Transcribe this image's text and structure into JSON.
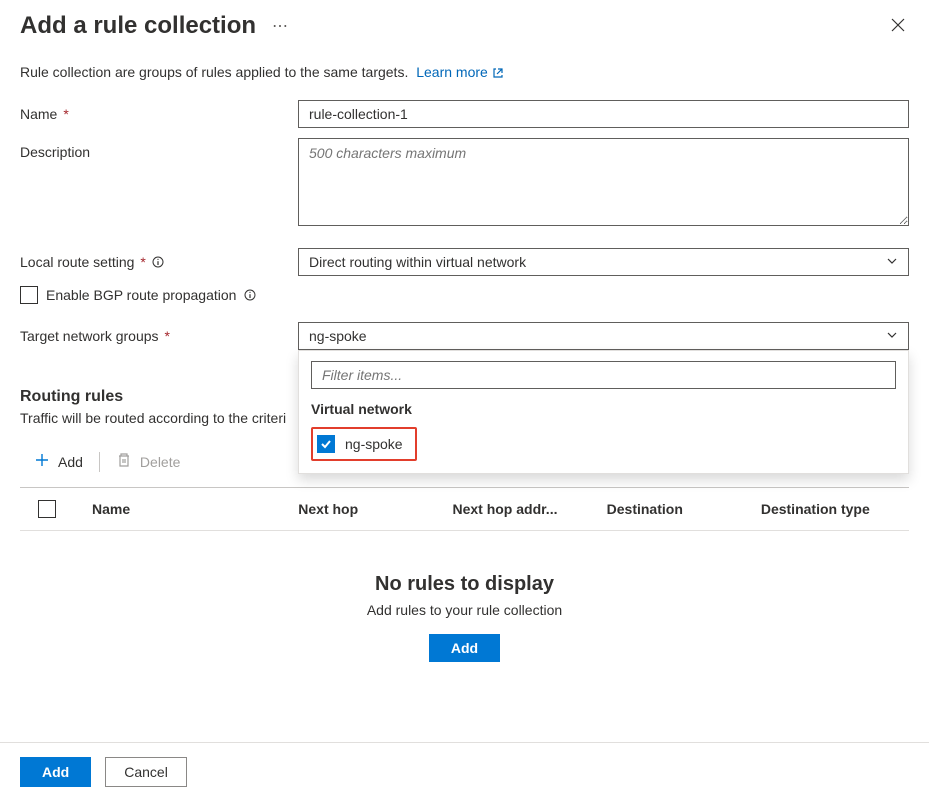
{
  "header": {
    "title": "Add a rule collection"
  },
  "intro": {
    "text": "Rule collection are groups of rules applied to the same targets.",
    "link_label": "Learn more"
  },
  "form": {
    "name_label": "Name",
    "name_value": "rule-collection-1",
    "description_label": "Description",
    "description_placeholder": "500 characters maximum",
    "local_route_label": "Local route setting",
    "local_route_value": "Direct routing within virtual network",
    "bgp_label": "Enable BGP route propagation",
    "target_label": "Target network groups",
    "target_value": "ng-spoke"
  },
  "dropdown": {
    "filter_placeholder": "Filter items...",
    "section_title": "Virtual network",
    "item_label": "ng-spoke"
  },
  "routing": {
    "heading": "Routing rules",
    "desc": "Traffic will be routed according to the criteri"
  },
  "toolbar": {
    "add_label": "Add",
    "delete_label": "Delete"
  },
  "table": {
    "col_name": "Name",
    "col_next_hop": "Next hop",
    "col_next_hop_addr": "Next hop addr...",
    "col_destination": "Destination",
    "col_destination_type": "Destination type"
  },
  "empty": {
    "title": "No rules to display",
    "desc": "Add rules to your rule collection",
    "button": "Add"
  },
  "footer": {
    "add_label": "Add",
    "cancel_label": "Cancel"
  }
}
